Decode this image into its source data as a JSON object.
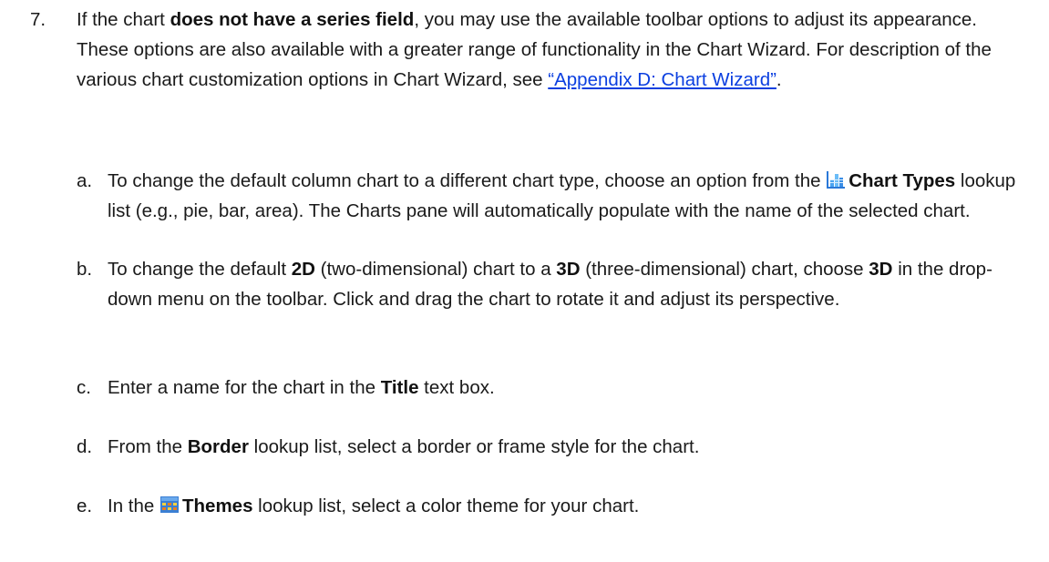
{
  "step": {
    "number": "7.",
    "intro_1": "If the chart ",
    "intro_bold": "does not have a series field",
    "intro_2": ", you may use the available toolbar options to adjust its appearance. These options are also available with a greater range of functionality in the Chart Wizard. For description of the various chart customization options in Chart Wizard, see ",
    "link_text": "“Appendix D: Chart Wizard”",
    "intro_end": "."
  },
  "substeps": {
    "a": {
      "letter": "a.",
      "t1": "To change the default column chart to a different chart type, choose an option from the ",
      "icon": "chart-types-icon",
      "bold": "Chart Types",
      "t2": " lookup list (e.g., pie, bar, area). The Charts pane will automatically populate with the name of the selected chart."
    },
    "b": {
      "letter": "b.",
      "t1": "To change the default ",
      "bold1": "2D",
      "t2": " (two-dimensional) chart to a ",
      "bold2": "3D",
      "t3": " (three-dimensional) chart, choose ",
      "bold3": "3D",
      "t4": " in the drop-down menu on the toolbar. Click and drag the chart to rotate it and adjust its perspective."
    },
    "c": {
      "letter": "c.",
      "t1": "Enter a name for the chart in the ",
      "bold": "Title",
      "t2": " text box."
    },
    "d": {
      "letter": "d.",
      "t1": "From the ",
      "bold": "Border",
      "t2": " lookup list, select a border or frame style for the chart."
    },
    "e": {
      "letter": "e.",
      "t1": "In the ",
      "icon": "themes-icon",
      "bold": "Themes",
      "t2": " lookup list, select a color theme for your chart."
    }
  },
  "colors": {
    "text": "#1a1a1a",
    "link": "#0b3fe0"
  }
}
